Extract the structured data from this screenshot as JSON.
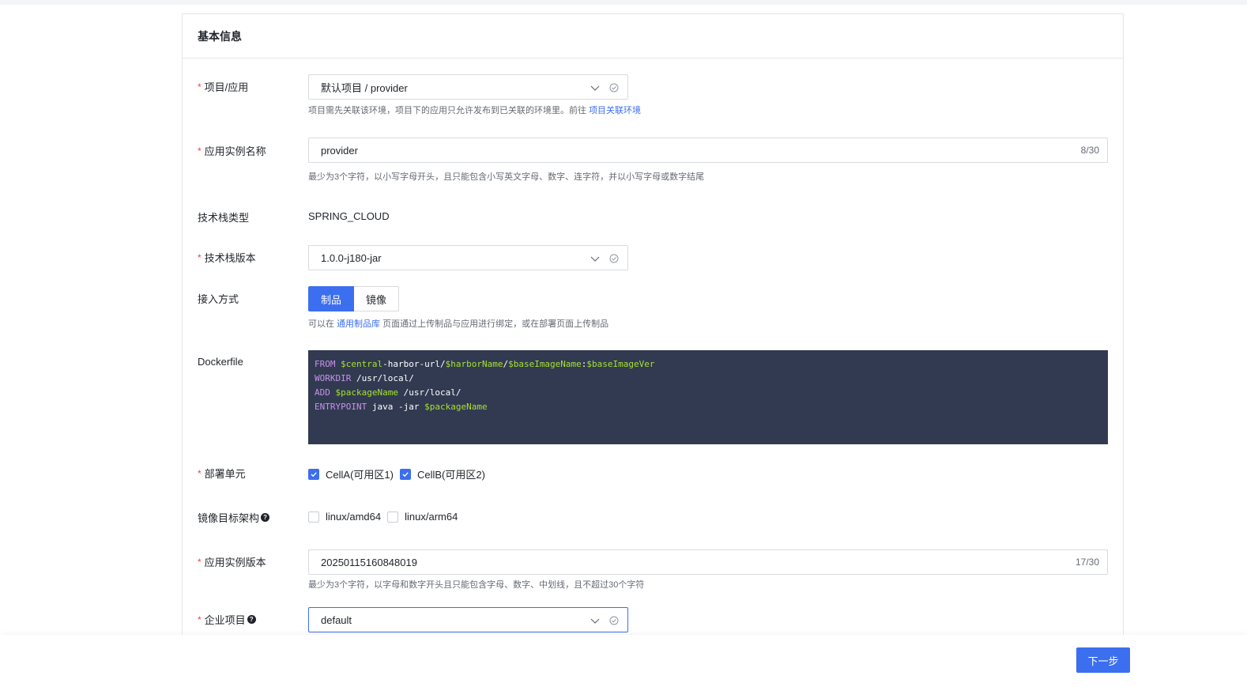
{
  "section_title": "基本信息",
  "required_mark": "*",
  "project_app": {
    "label": "项目/应用",
    "value": "默认项目 / provider",
    "hint": "项目需先关联该环境，项目下的应用只允许发布到已关联的环境里。前往",
    "hint_link": "项目关联环境"
  },
  "instance_name": {
    "label": "应用实例名称",
    "value": "provider",
    "counter": "8/30",
    "hint": "最少为3个字符，以小写字母开头，且只能包含小写英文字母、数字、连字符，并以小写字母或数字结尾"
  },
  "stack_type": {
    "label": "技术栈类型",
    "value": "SPRING_CLOUD"
  },
  "stack_version": {
    "label": "技术栈版本",
    "value": "1.0.0-j180-jar"
  },
  "access_mode": {
    "label": "接入方式",
    "options": [
      "制品",
      "镜像"
    ],
    "selected": "制品",
    "hint_prefix": "可以在",
    "hint_link": "通用制品库",
    "hint_suffix": "页面通过上传制品与应用进行绑定，或在部署页面上传制品"
  },
  "dockerfile": {
    "label": "Dockerfile",
    "lines": [
      [
        {
          "t": "FROM",
          "c": "kw"
        },
        {
          "t": " ",
          "c": ""
        },
        {
          "t": "$central",
          "c": "var"
        },
        {
          "t": "-harbor-url/",
          "c": ""
        },
        {
          "t": "$harborName",
          "c": "var"
        },
        {
          "t": "/",
          "c": ""
        },
        {
          "t": "$baseImageName",
          "c": "var"
        },
        {
          "t": ":",
          "c": ""
        },
        {
          "t": "$baseImageVer",
          "c": "var"
        }
      ],
      [
        {
          "t": "WORKDIR",
          "c": "kw"
        },
        {
          "t": " /usr/local/",
          "c": ""
        }
      ],
      [
        {
          "t": "ADD",
          "c": "kw"
        },
        {
          "t": " ",
          "c": ""
        },
        {
          "t": "$packageName",
          "c": "var"
        },
        {
          "t": " /usr/local/",
          "c": ""
        }
      ],
      [
        {
          "t": "ENTRYPOINT",
          "c": "kw"
        },
        {
          "t": " java -jar ",
          "c": ""
        },
        {
          "t": "$packageName",
          "c": "var"
        }
      ]
    ]
  },
  "deploy_unit": {
    "label": "部署单元",
    "options": [
      {
        "label": "CellA(可用区1)",
        "checked": true
      },
      {
        "label": "CellB(可用区2)",
        "checked": true
      }
    ]
  },
  "image_arch": {
    "label": "镜像目标架构",
    "help": "?",
    "options": [
      {
        "label": "linux/amd64",
        "checked": false
      },
      {
        "label": "linux/arm64",
        "checked": false
      }
    ]
  },
  "instance_version": {
    "label": "应用实例版本",
    "value": "20250115160848019",
    "counter": "17/30",
    "hint": "最少为3个字符，以字母和数字开头且只能包含字母、数字、中划线，且不超过30个字符"
  },
  "enterprise_project": {
    "label": "企业项目",
    "help": "?",
    "value": "default"
  },
  "footer": {
    "next_label": "下一步"
  },
  "colors": {
    "primary": "#3c6ef0",
    "required": "#f53f3f",
    "code_bg": "#323a52"
  }
}
